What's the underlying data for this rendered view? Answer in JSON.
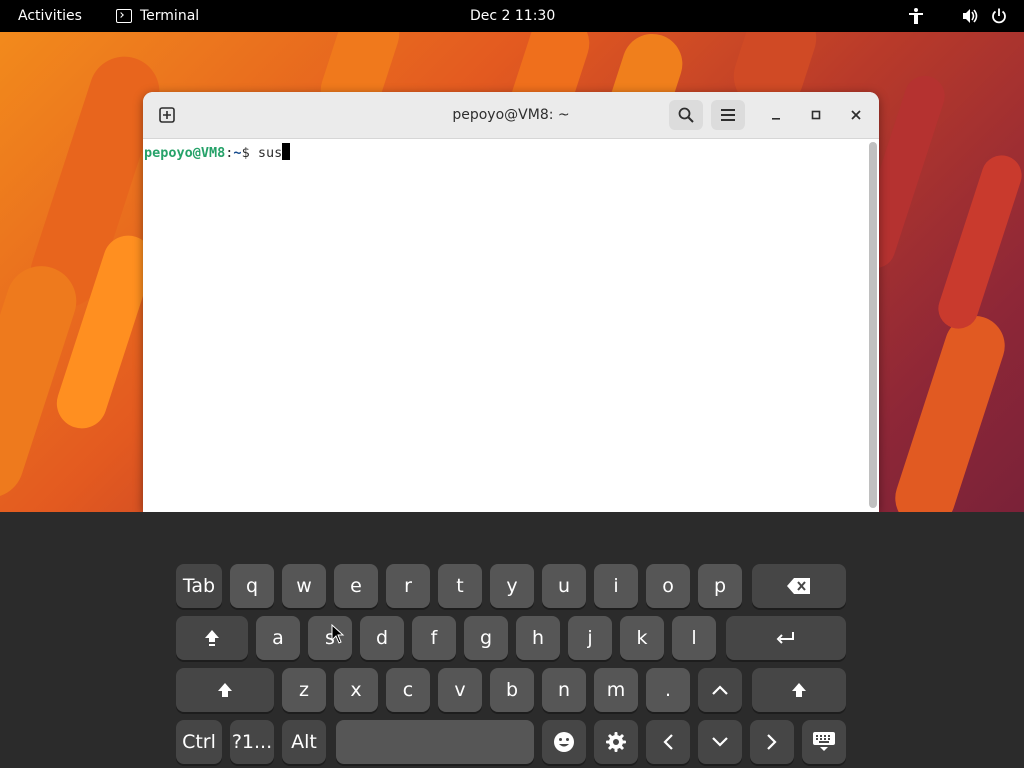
{
  "topbar": {
    "activities": "Activities",
    "app_name": "Terminal",
    "clock": "Dec 2  11:30"
  },
  "window": {
    "title": "pepoyo@VM8: ~"
  },
  "terminal": {
    "prompt_user": "pepoyo@VM8",
    "prompt_sep": ":",
    "prompt_path": "~",
    "prompt_symbol": "$ ",
    "typed_text": "sus"
  },
  "keyboard": {
    "row1": [
      "Tab",
      "q",
      "w",
      "e",
      "r",
      "t",
      "y",
      "u",
      "i",
      "o",
      "p"
    ],
    "row2": [
      "a",
      "s",
      "d",
      "f",
      "g",
      "h",
      "j",
      "k",
      "l"
    ],
    "row3": [
      "z",
      "x",
      "c",
      "v",
      "b",
      "n",
      "m",
      "."
    ],
    "row4": {
      "ctrl": "Ctrl",
      "symbols": "?1...",
      "alt": "Alt"
    }
  }
}
